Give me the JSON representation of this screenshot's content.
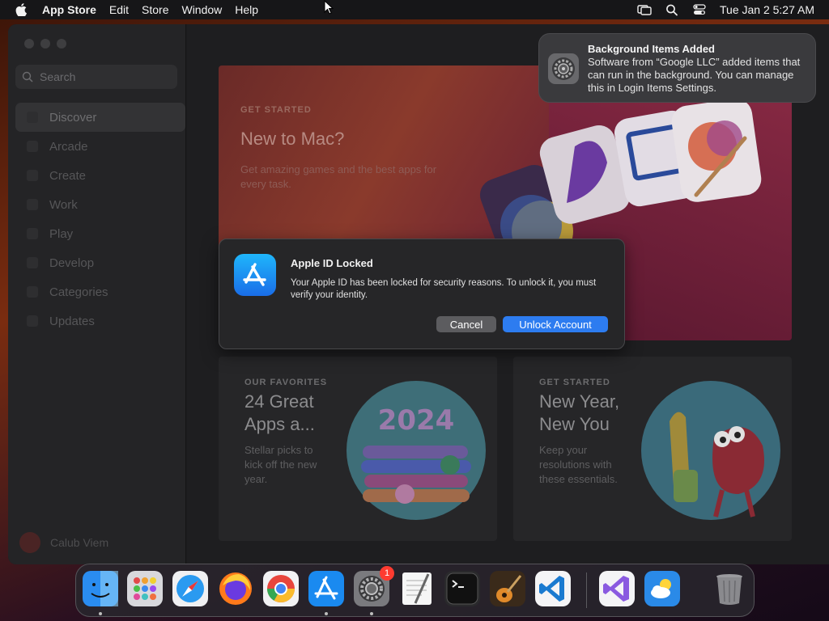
{
  "menubar": {
    "app_name": "App Store",
    "items": [
      "Edit",
      "Store",
      "Window",
      "Help"
    ],
    "clock": "Tue Jan 2  5:27 AM"
  },
  "sidebar": {
    "search_placeholder": "Search",
    "items": [
      {
        "label": "Discover",
        "active": true
      },
      {
        "label": "Arcade"
      },
      {
        "label": "Create"
      },
      {
        "label": "Work"
      },
      {
        "label": "Play"
      },
      {
        "label": "Develop"
      },
      {
        "label": "Categories"
      },
      {
        "label": "Updates"
      }
    ],
    "user_name": "Calub Viem"
  },
  "hero": {
    "eyebrow": "GET STARTED",
    "title": "New to Mac?",
    "subtitle": "Get amazing games and the best apps for every task."
  },
  "cards": [
    {
      "eyebrow": "OUR FAVORITES",
      "title": "24 Great Apps a...",
      "subtitle": "Stellar picks to kick off the new year.",
      "art_text": "2024"
    },
    {
      "eyebrow": "GET STARTED",
      "title": "New Year, New You",
      "subtitle": "Keep your resolutions with these essentials."
    }
  ],
  "notification": {
    "title": "Background Items Added",
    "body": "Software from “Google LLC” added items that can run in the background. You can manage this in Login Items Settings."
  },
  "dialog": {
    "title": "Apple ID Locked",
    "message": "Your Apple ID has been locked for security reasons. To unlock it, you must verify your identity.",
    "cancel_label": "Cancel",
    "confirm_label": "Unlock Account"
  },
  "dock": {
    "apps": [
      "finder",
      "launchpad",
      "safari",
      "firefox",
      "chrome",
      "app-store",
      "system-settings",
      "textedit",
      "terminal",
      "garageband",
      "vscode",
      "visual-studio",
      "weather",
      "trash"
    ],
    "settings_badge": "1"
  },
  "colors": {
    "accent": "#2d7cf0",
    "badge": "#ff3b30"
  }
}
